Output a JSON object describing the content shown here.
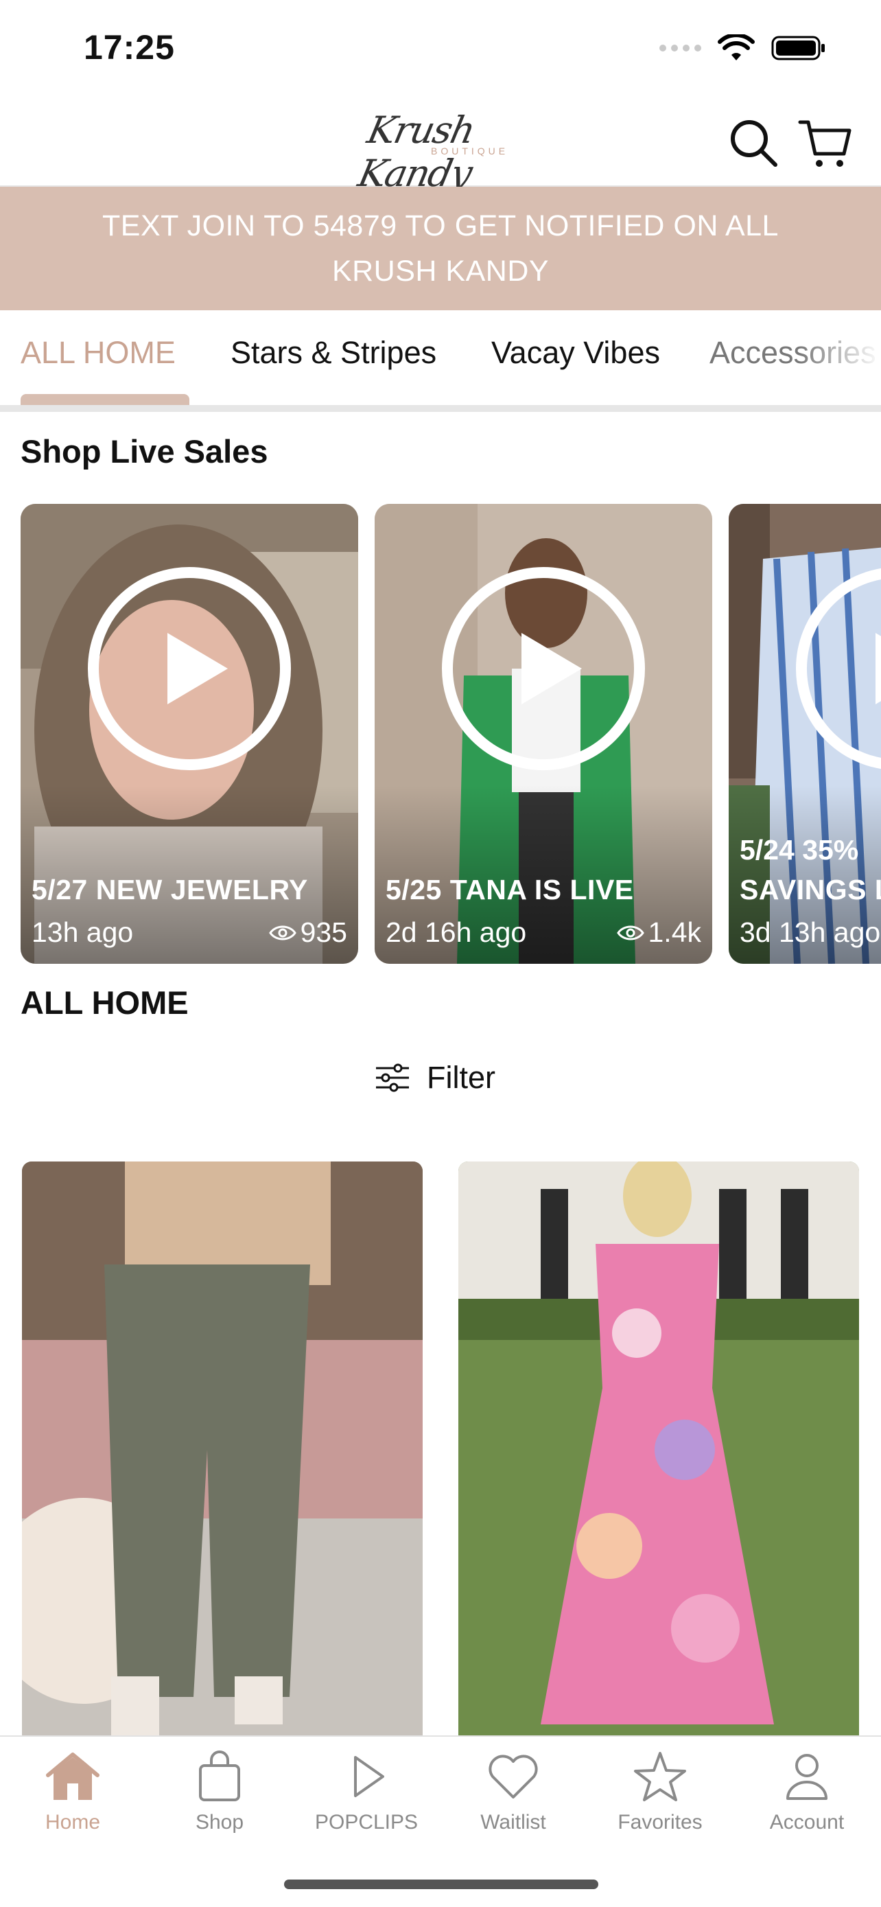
{
  "status_bar": {
    "time": "17:25"
  },
  "header": {
    "logo_script": "Krush Kandy",
    "logo_sub": "BOUTIQUE",
    "search_icon": "search-icon",
    "cart_icon": "cart-icon"
  },
  "banner": {
    "text": "TEXT JOIN TO 54879 TO GET NOTIFIED ON ALL KRUSH KANDY"
  },
  "tabs": [
    {
      "label": "ALL HOME",
      "active": true
    },
    {
      "label": "Stars & Stripes",
      "active": false
    },
    {
      "label": "Vacay Vibes",
      "active": false
    },
    {
      "label": "Accessories",
      "active": false
    }
  ],
  "live_section": {
    "title": "Shop Live Sales",
    "cards": [
      {
        "title": "5/27 NEW JEWELRY",
        "time": "13h ago",
        "views": "935"
      },
      {
        "title": "5/25 TANA IS LIVE",
        "time": "2d 16h ago",
        "views": "1.4k"
      },
      {
        "title_line1": "5/24 35%",
        "title_line2": "SAVINGS L",
        "time": "3d 13h ago"
      }
    ]
  },
  "products_section": {
    "title": "ALL HOME",
    "filter_label": "Filter"
  },
  "bottom_nav": [
    {
      "label": "Home",
      "icon": "home-icon",
      "active": true
    },
    {
      "label": "Shop",
      "icon": "bag-icon",
      "active": false
    },
    {
      "label": "POPCLIPS",
      "icon": "play-icon",
      "active": false
    },
    {
      "label": "Waitlist",
      "icon": "heart-icon",
      "active": false
    },
    {
      "label": "Favorites",
      "icon": "star-icon",
      "active": false
    },
    {
      "label": "Account",
      "icon": "user-icon",
      "active": false
    }
  ],
  "colors": {
    "accent": "#c9a391",
    "banner_bg": "#d8beb1",
    "nav_inactive": "#8a8a8a"
  }
}
